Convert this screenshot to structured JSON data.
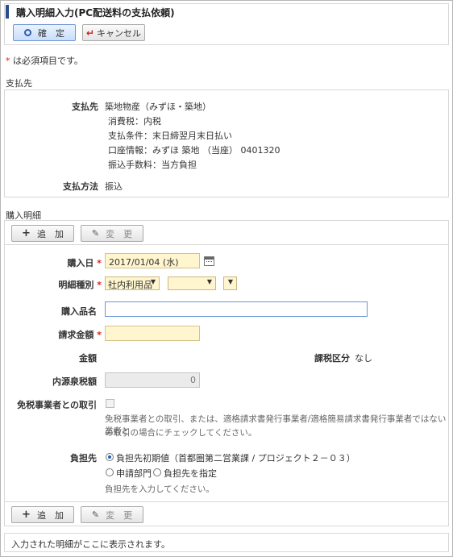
{
  "page": {
    "title": "購入明細入力(PC配送料の支払依頼)",
    "confirm_label": "確　定",
    "cancel_label": "キャンセル",
    "required_note": "は必須項目です。",
    "required_mark": "*"
  },
  "payee": {
    "section_label": "支払先",
    "field_label": "支払先",
    "name": "築地物産（みずほ・築地）",
    "tax": "消費税：内税",
    "terms": "支払条件：末日締翌月末日払い",
    "account": "口座情報：みずほ 築地 （当座） 0401320",
    "fee": "振込手数料：当方負担",
    "method_label": "支払方法",
    "method_value": "振込"
  },
  "detail": {
    "section_label": "購入明細",
    "add_label": "追　加",
    "change_label": "変　更",
    "purchase_date_label": "購入日",
    "purchase_date": "2017/01/04 (水)",
    "type_label": "明細種別",
    "type_value": "社内利用品",
    "type_value2": "",
    "type_value3": "",
    "item_name_label": "購入品名",
    "item_name_value": "",
    "amount_label": "請求金額",
    "amount_value": "",
    "price_label": "金額",
    "tax_class_label": "課税区分",
    "tax_class_value": "なし",
    "withholding_label": "内源泉税額",
    "withholding_value": "0",
    "exempt_label": "免税事業者との取引",
    "exempt_help_1": "免税事業者との取引、または、適格請求書発行事業者/適格簡易請求書発行事業者ではない業者と",
    "exempt_help_2": "の取引の場合にチェックしてください。",
    "burden_label": "負担先",
    "burden_option_default": "負担先初期値（首都圏第二営業課 / プロジェクト２－０３）",
    "burden_option_dept": "申請部門",
    "burden_option_specify": "負担先を指定",
    "burden_help": "負担先を入力してください。"
  },
  "footer": {
    "note": "入力された明細がここに表示されます。"
  }
}
